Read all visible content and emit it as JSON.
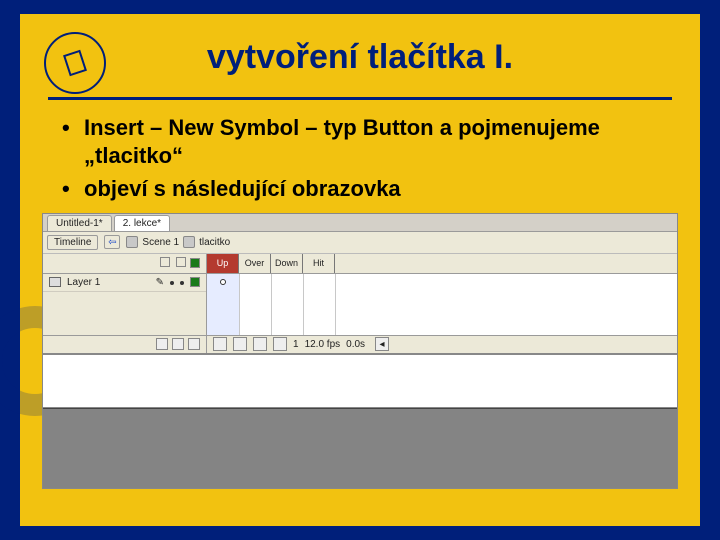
{
  "title": "vytvoření tlačítka I.",
  "bullets": {
    "b1": "Insert – New Symbol – typ Button a pojmenujeme „tlacitko“",
    "b2": "objeví s následující obrazovka"
  },
  "editor": {
    "tabs": {
      "t1": "Untitled-1*",
      "t2": "2. lekce*"
    },
    "timeline_label": "Timeline",
    "breadcrumb": {
      "scene": "Scene 1",
      "symbol": "tlacitko"
    },
    "states": {
      "up": "Up",
      "over": "Over",
      "down": "Down",
      "hit": "Hit"
    },
    "layer": "Layer 1",
    "footer": {
      "frame": "1",
      "fps_label": "12.0 fps",
      "time": "0.0s"
    }
  }
}
